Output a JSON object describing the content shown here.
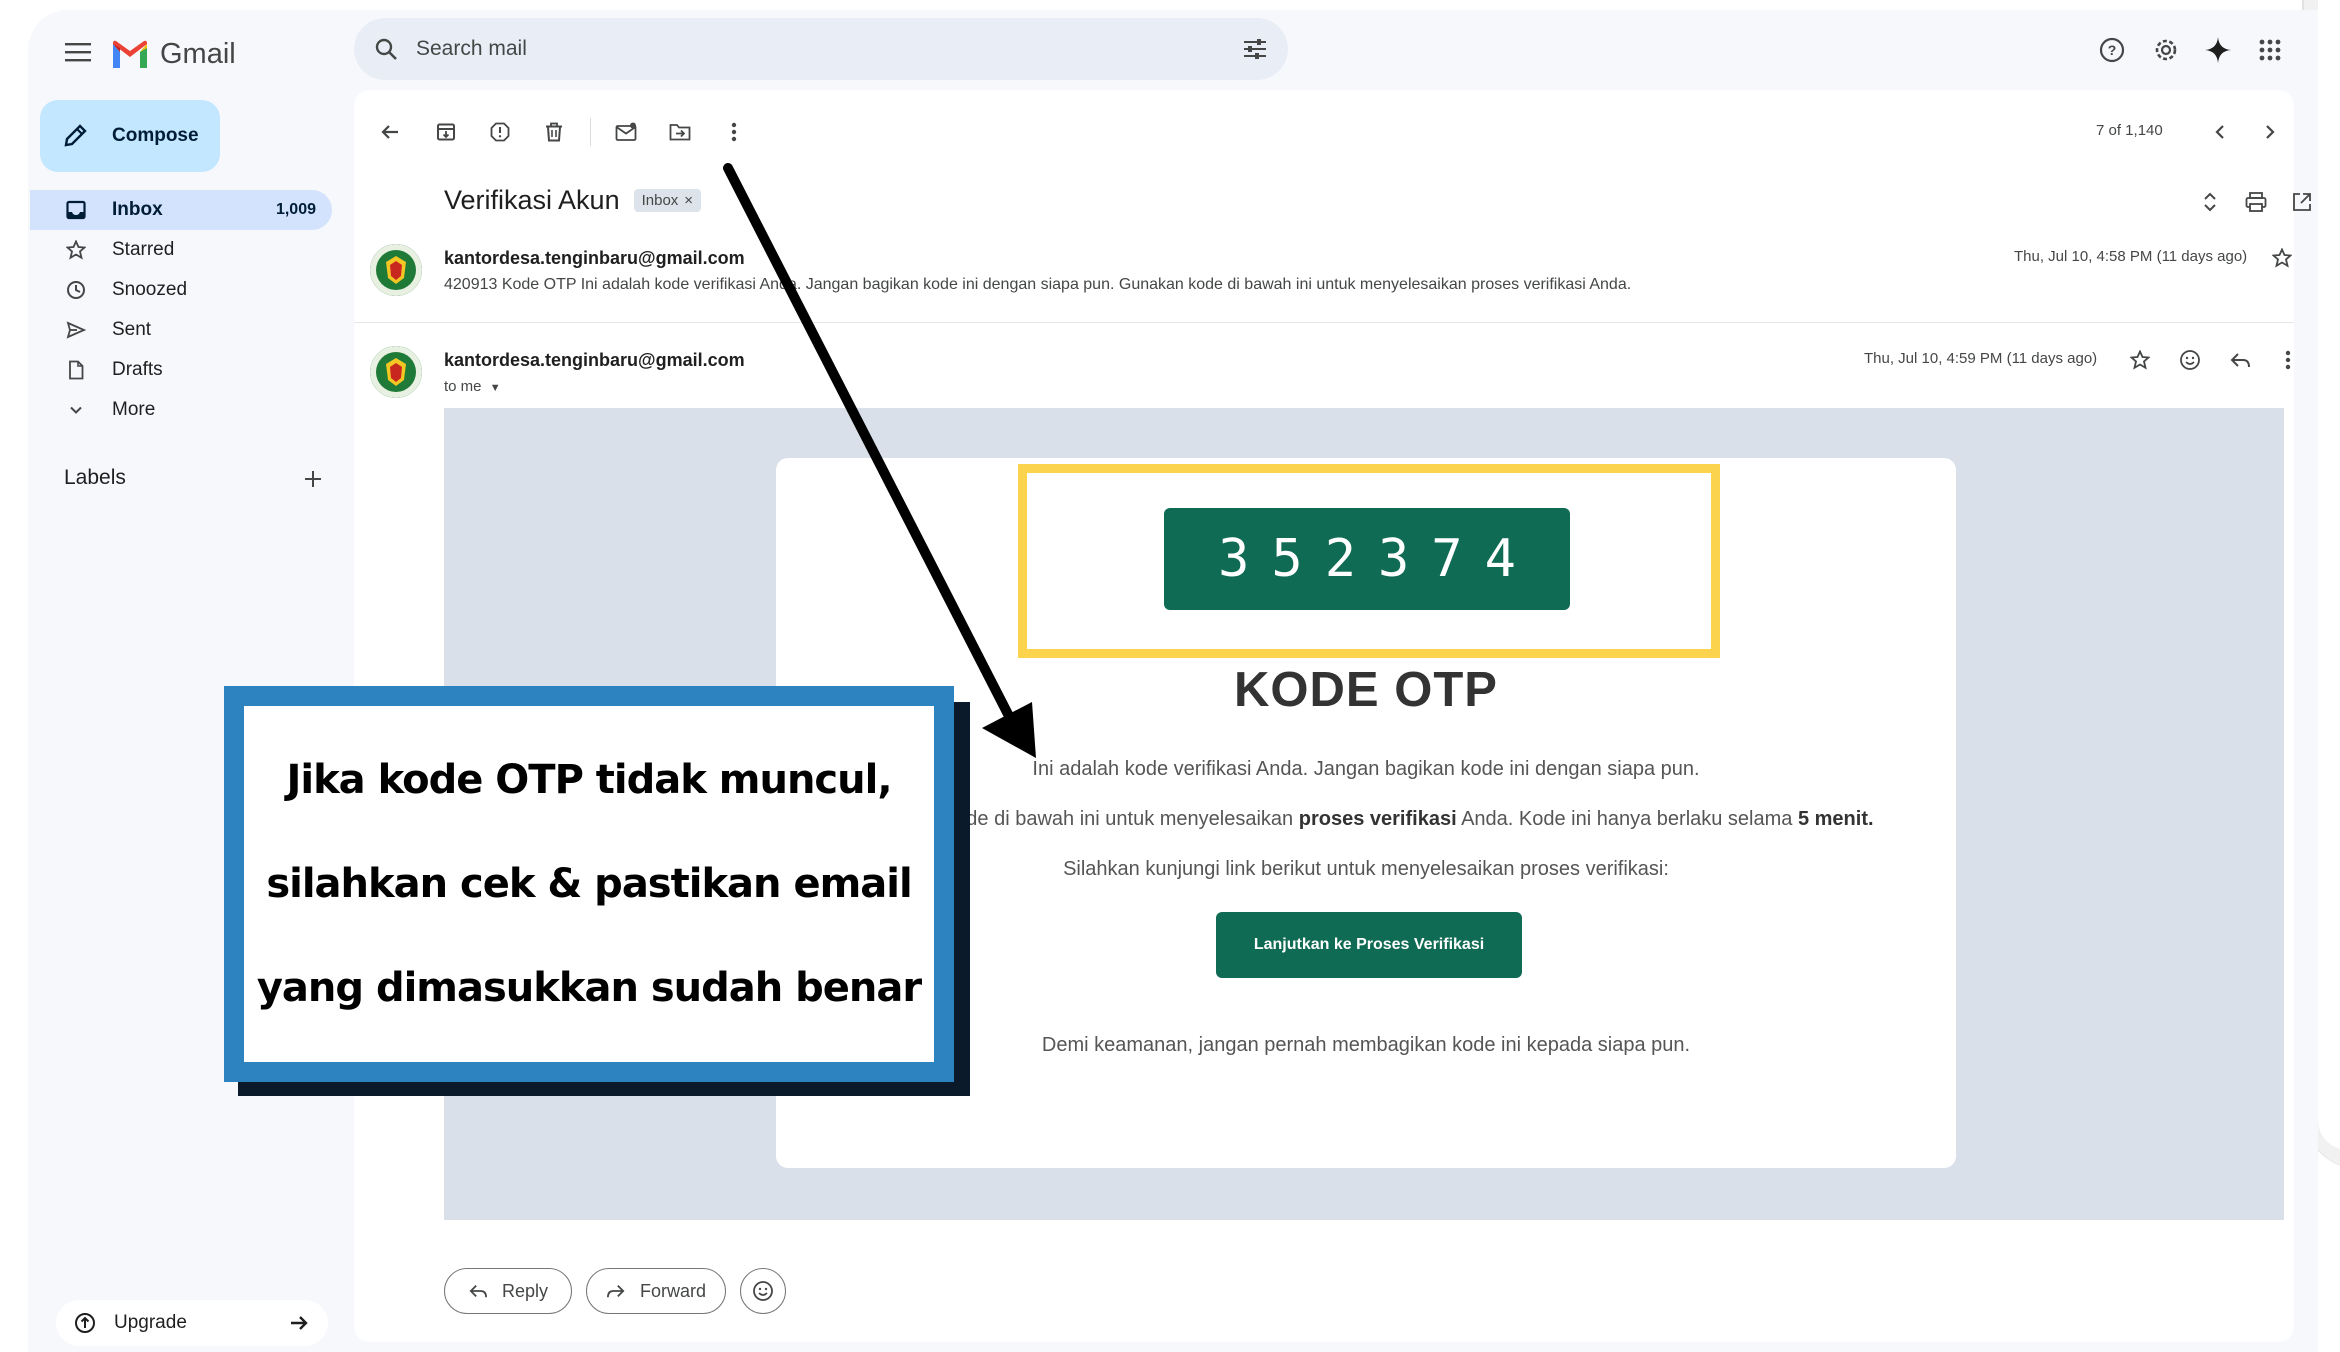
{
  "header": {
    "app_name": "Gmail",
    "search_placeholder": "Search mail"
  },
  "sidebar": {
    "compose_label": "Compose",
    "items": [
      {
        "label": "Inbox",
        "count": "1,009",
        "icon": "inbox-icon",
        "active": true
      },
      {
        "label": "Starred",
        "count": "",
        "icon": "star-icon"
      },
      {
        "label": "Snoozed",
        "count": "",
        "icon": "clock-icon"
      },
      {
        "label": "Sent",
        "count": "",
        "icon": "send-icon"
      },
      {
        "label": "Drafts",
        "count": "",
        "icon": "draft-icon"
      },
      {
        "label": "More",
        "count": "",
        "icon": "chevron-down-icon"
      }
    ],
    "labels_heading": "Labels",
    "upgrade_label": "Upgrade"
  },
  "toolbar": {
    "pager": "7 of 1,140"
  },
  "thread": {
    "subject": "Verifikasi Akun",
    "label_chip": "Inbox",
    "messages": [
      {
        "sender": "kantordesa.tenginbaru@gmail.com",
        "snippet": "420913 Kode OTP Ini adalah kode verifikasi Anda. Jangan bagikan kode ini dengan siapa pun. Gunakan kode di bawah ini untuk menyelesaikan proses verifikasi Anda.",
        "date": "Thu, Jul 10, 4:58 PM (11 days ago)"
      },
      {
        "sender": "kantordesa.tenginbaru@gmail.com",
        "recipient": "to me",
        "date": "Thu, Jul 10, 4:59 PM (11 days ago)"
      }
    ]
  },
  "email_content": {
    "otp_code": "352374",
    "title": "KODE OTP",
    "line1": "Ini adalah kode verifikasi Anda. Jangan bagikan kode ini dengan siapa pun.",
    "line2_pre": "Gunakan kode di bawah ini untuk menyelesaikan ",
    "line2_bold": "proses verifikasi",
    "line2_mid": " Anda. Kode ini hanya berlaku selama ",
    "line2_bold2": "5 menit.",
    "line3": "Silahkan kunjungi link berikut untuk menyelesaikan proses verifikasi:",
    "button": "Lanjutkan ke Proses Verifikasi",
    "footer": "Demi keamanan, jangan pernah membagikan kode ini kepada siapa pun."
  },
  "actions": {
    "reply": "Reply",
    "forward": "Forward"
  },
  "callout": {
    "line1": "Jika kode OTP tidak muncul,",
    "line2": "silahkan cek & pastikan email",
    "line3": "yang dimasukkan sudah benar"
  },
  "colors": {
    "brand_green": "#0f6b54",
    "otp_frame": "#fcd34d",
    "callout_border": "#2d82c0",
    "compose_bg": "#c2e7ff",
    "active_nav": "#d3e3fd"
  }
}
